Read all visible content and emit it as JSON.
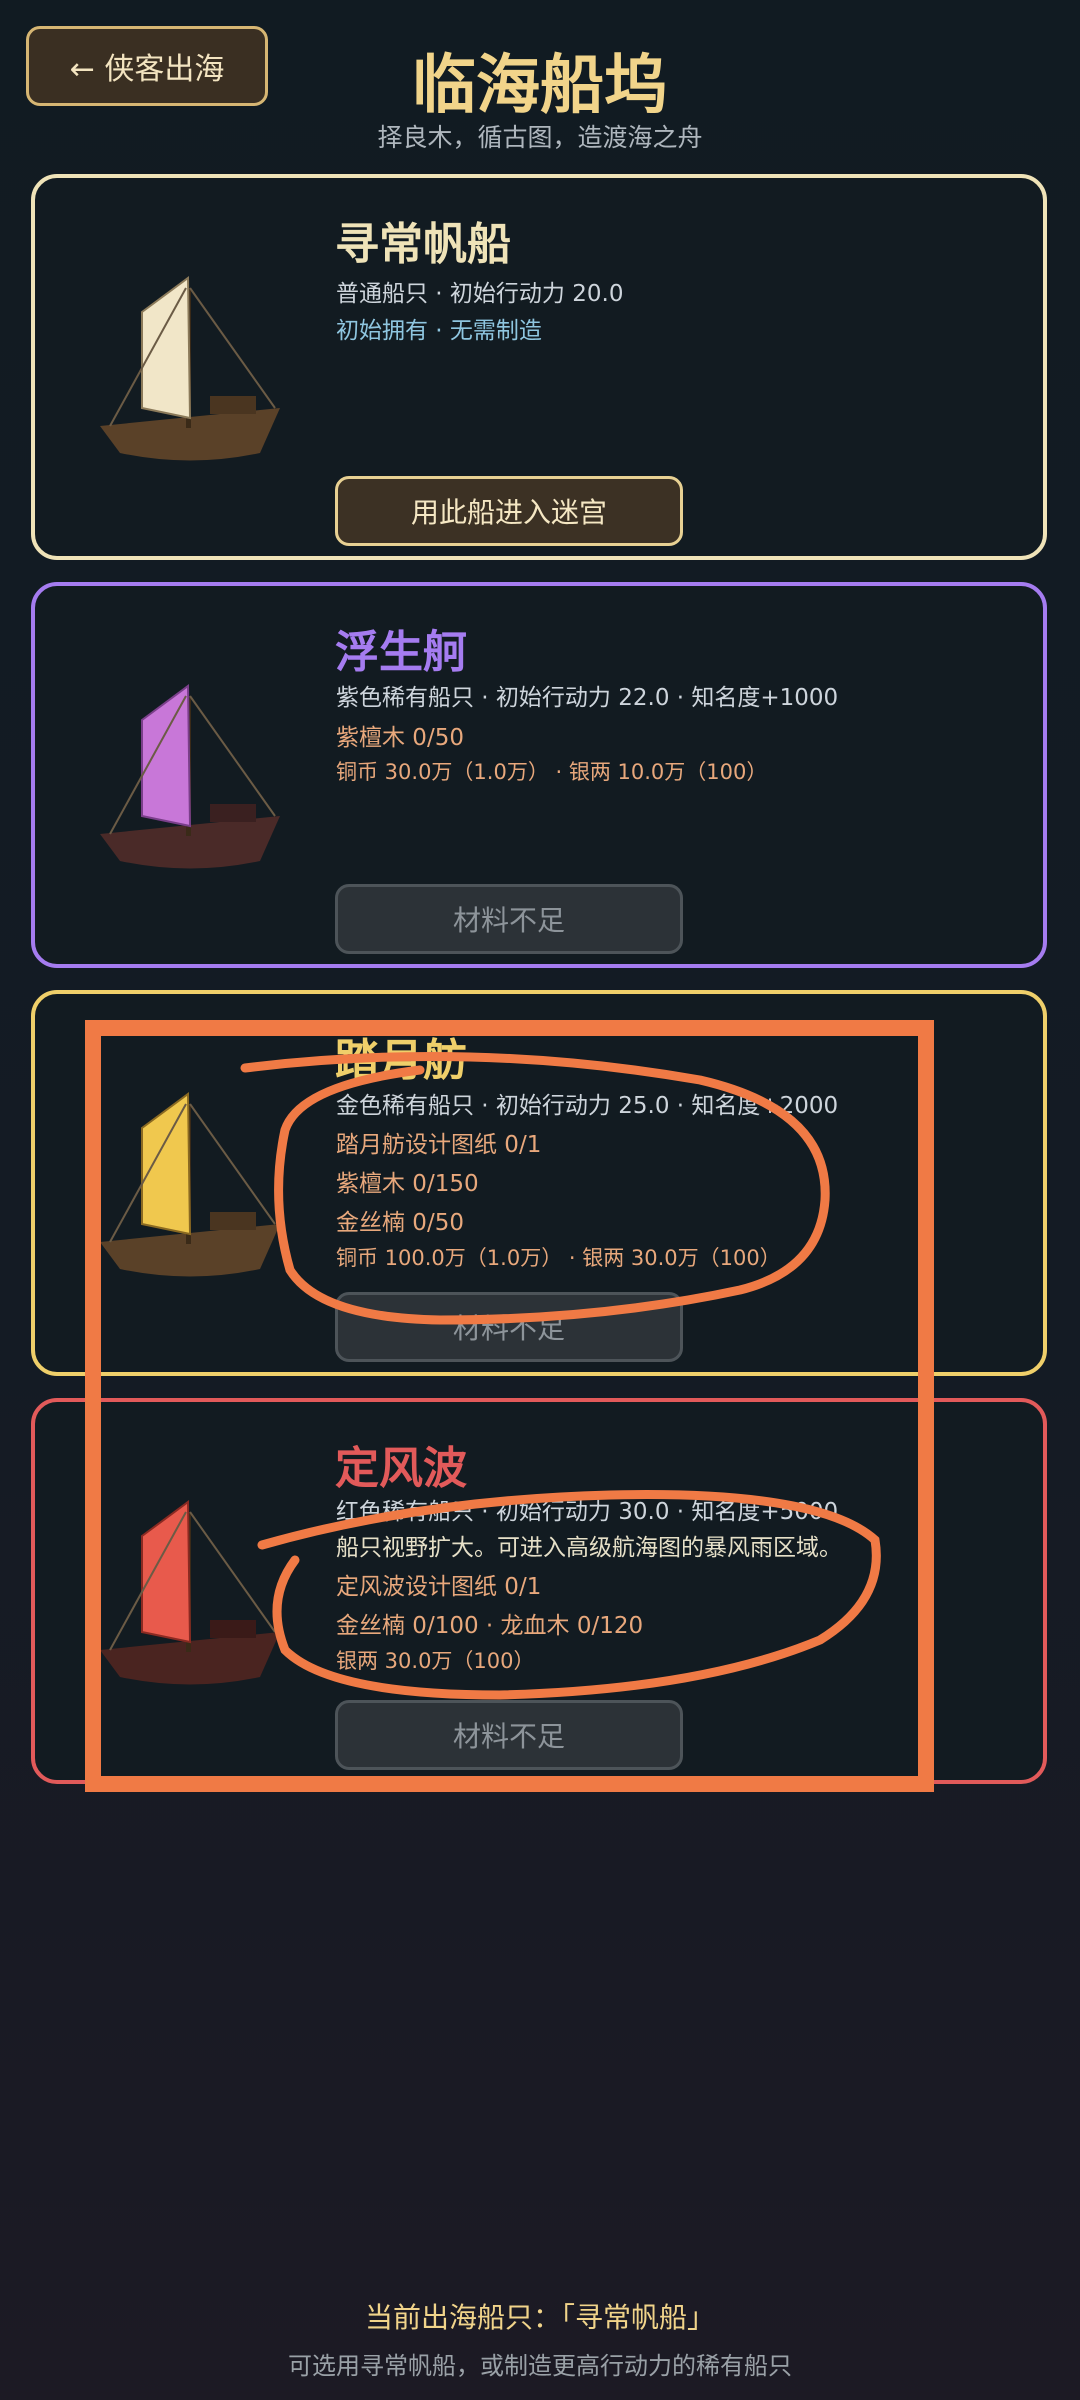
{
  "header": {
    "back_label": "← 侠客出海",
    "title": "临海船坞",
    "subtitle": "择良木，循古图，造渡海之舟"
  },
  "ships": [
    {
      "name": "寻常帆船",
      "color": "#efe3b8",
      "sail_color": "#f1e6c8",
      "info": "普通船只 · 初始行动力 20.0",
      "owned": "初始拥有 · 无需制造",
      "action": "用此船进入迷宫"
    },
    {
      "name": "浮生舸",
      "color": "#a57cf0",
      "sail_color": "#c877d8",
      "info": "紫色稀有船只 · 初始行动力 22.0 · 知名度+1000",
      "materials": [
        "紫檀木  0/50"
      ],
      "cost": "铜币 30.0万（1.0万） · 银两 10.0万（100）",
      "action": "材料不足"
    },
    {
      "name": "踏月舫",
      "color": "#efcf6a",
      "sail_color": "#f0c84e",
      "info": "金色稀有船只 · 初始行动力 25.0 · 知名度+2000",
      "materials": [
        "踏月舫设计图纸  0/1",
        "紫檀木  0/150",
        "金丝楠  0/50"
      ],
      "cost": "铜币 100.0万（1.0万） · 银两 30.0万（100）",
      "action": "材料不足"
    },
    {
      "name": "定风波",
      "color": "#e25a5a",
      "sail_color": "#e85a4c",
      "info": "红色稀有船只 · 初始行动力 30.0 · 知名度+5000",
      "note": "船只视野扩大。可进入高级航海图的暴风雨区域。",
      "materials": [
        "定风波设计图纸  0/1",
        "金丝楠 0/100 · 龙血木 0/120"
      ],
      "cost": "银两 30.0万（100）",
      "action": "材料不足"
    }
  ],
  "footer": {
    "current": "当前出海船只：「寻常帆船」",
    "hint": "可选用寻常帆船，或制造更高行动力的稀有船只"
  },
  "annotation_color": "#f07a45"
}
